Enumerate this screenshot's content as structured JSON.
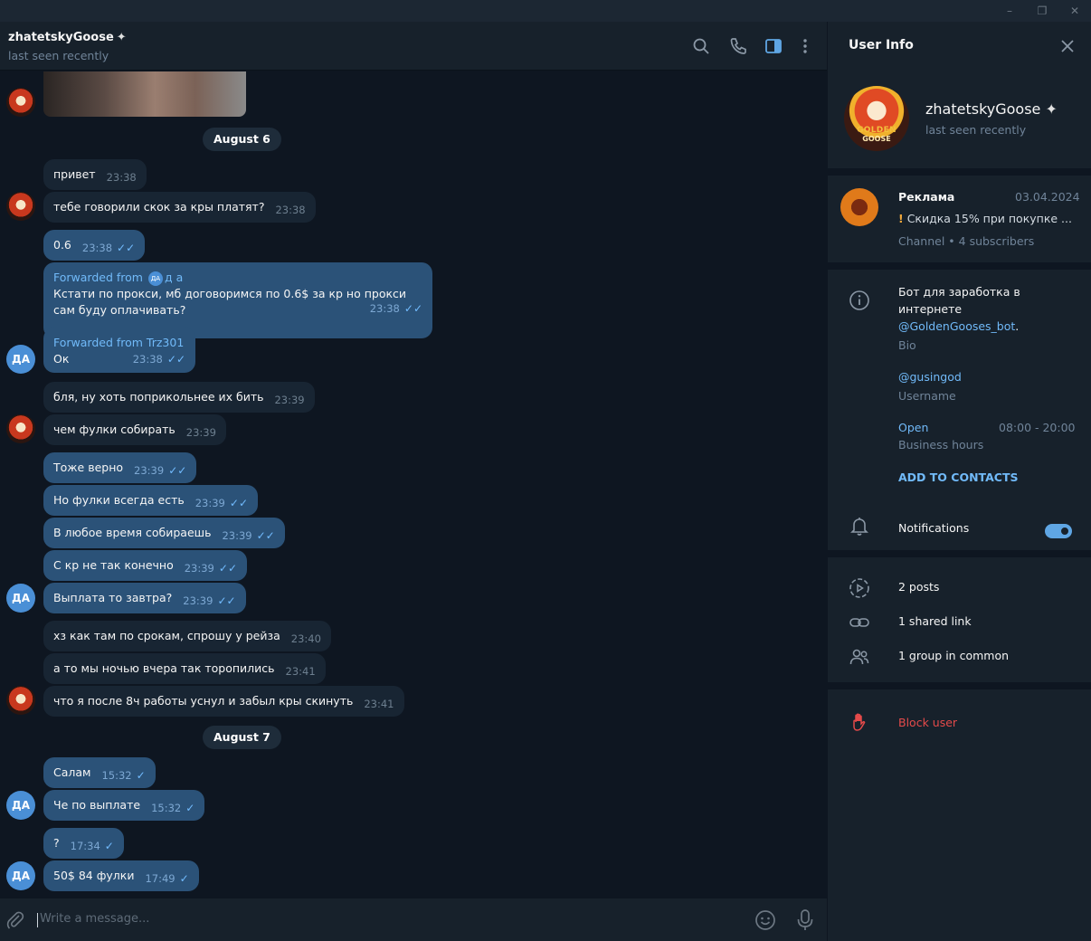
{
  "colors": {
    "background": "#0e1621",
    "header": "#17212b",
    "bubble_in": "#182533",
    "bubble_out": "#2b5278",
    "accent": "#71baf9",
    "danger": "#e54a4a"
  },
  "chat": {
    "title": "zhatetskyGoose",
    "status": "last seen recently",
    "icons": [
      "search-icon",
      "phone-icon",
      "sidebar-toggle-icon",
      "more-vertical-icon"
    ]
  },
  "messages": {
    "date1": "August 6",
    "date2": "August 7",
    "m1": {
      "text": "привет",
      "time": "23:38"
    },
    "m2": {
      "text": "тебе говорили скок за кры платят?",
      "time": "23:38"
    },
    "m3": {
      "text": "0.6",
      "time": "23:38"
    },
    "m4": {
      "fwd_label": "Forwarded from",
      "fwd_from": "д а",
      "fwd_avatar": "ДА",
      "text": "Кстати по прокси, мб договоримся по 0.6$ за кр но прокси сам буду оплачивать?",
      "time": "23:38"
    },
    "m5": {
      "fwd_label": "Forwarded from Trz301",
      "text": "Ок",
      "time": "23:38"
    },
    "m6": {
      "text": "бля, ну хоть поприкольнее их бить",
      "time": "23:39"
    },
    "m7": {
      "text": "чем фулки собирать",
      "time": "23:39"
    },
    "m8": {
      "text": "Тоже верно",
      "time": "23:39"
    },
    "m9": {
      "text": "Но фулки всегда есть",
      "time": "23:39"
    },
    "m10": {
      "text": "В любое время собираешь",
      "time": "23:39"
    },
    "m11": {
      "text": "С кр не так конечно",
      "time": "23:39"
    },
    "m12": {
      "text": "Выплата то завтра?",
      "time": "23:39"
    },
    "m13": {
      "text": "хз как там по срокам, спрошу у рейза",
      "time": "23:40"
    },
    "m14": {
      "text": "а то мы ночью вчера так торопились",
      "time": "23:41"
    },
    "m15": {
      "text": "что я после 8ч работы уснул и забыл кры скинуть",
      "time": "23:41"
    },
    "m16": {
      "text": "Салам",
      "time": "15:32"
    },
    "m17": {
      "text": "Че по выплате",
      "time": "15:32"
    },
    "m18": {
      "text": "?",
      "time": "17:34"
    },
    "m19": {
      "text": "50$ 84 фулки",
      "time": "17:49"
    },
    "avatar_da": "ДА"
  },
  "composer": {
    "placeholder": "Write a message...",
    "icons": [
      "paperclip-icon",
      "emoji-icon",
      "microphone-icon"
    ]
  },
  "panel": {
    "title": "User Info",
    "profile": {
      "name": "zhatetskyGoose",
      "status": "last seen recently",
      "avatar_text1": "GOLDEN",
      "avatar_text2": "GOOSE"
    },
    "channel": {
      "name": "Реклама",
      "date": "03.04.2024",
      "preview": "Скидка 15% при покупке ...",
      "preview_mark": "!",
      "meta": "Channel • 4 subscribers"
    },
    "bio": {
      "line1": "Бот для заработка в",
      "line2": "интернете",
      "link": "@GoldenGooses_bot",
      "punct": ".",
      "label": "Bio"
    },
    "username": {
      "value": "@gusingod",
      "label": "Username"
    },
    "hours": {
      "status": "Open",
      "range": "08:00 - 20:00",
      "label": "Business hours"
    },
    "add_contacts": "ADD TO CONTACTS",
    "notifications": {
      "label": "Notifications",
      "enabled": true
    },
    "shared": {
      "posts": "2 posts",
      "links": "1 shared link",
      "groups": "1 group in common"
    },
    "block": "Block user"
  }
}
